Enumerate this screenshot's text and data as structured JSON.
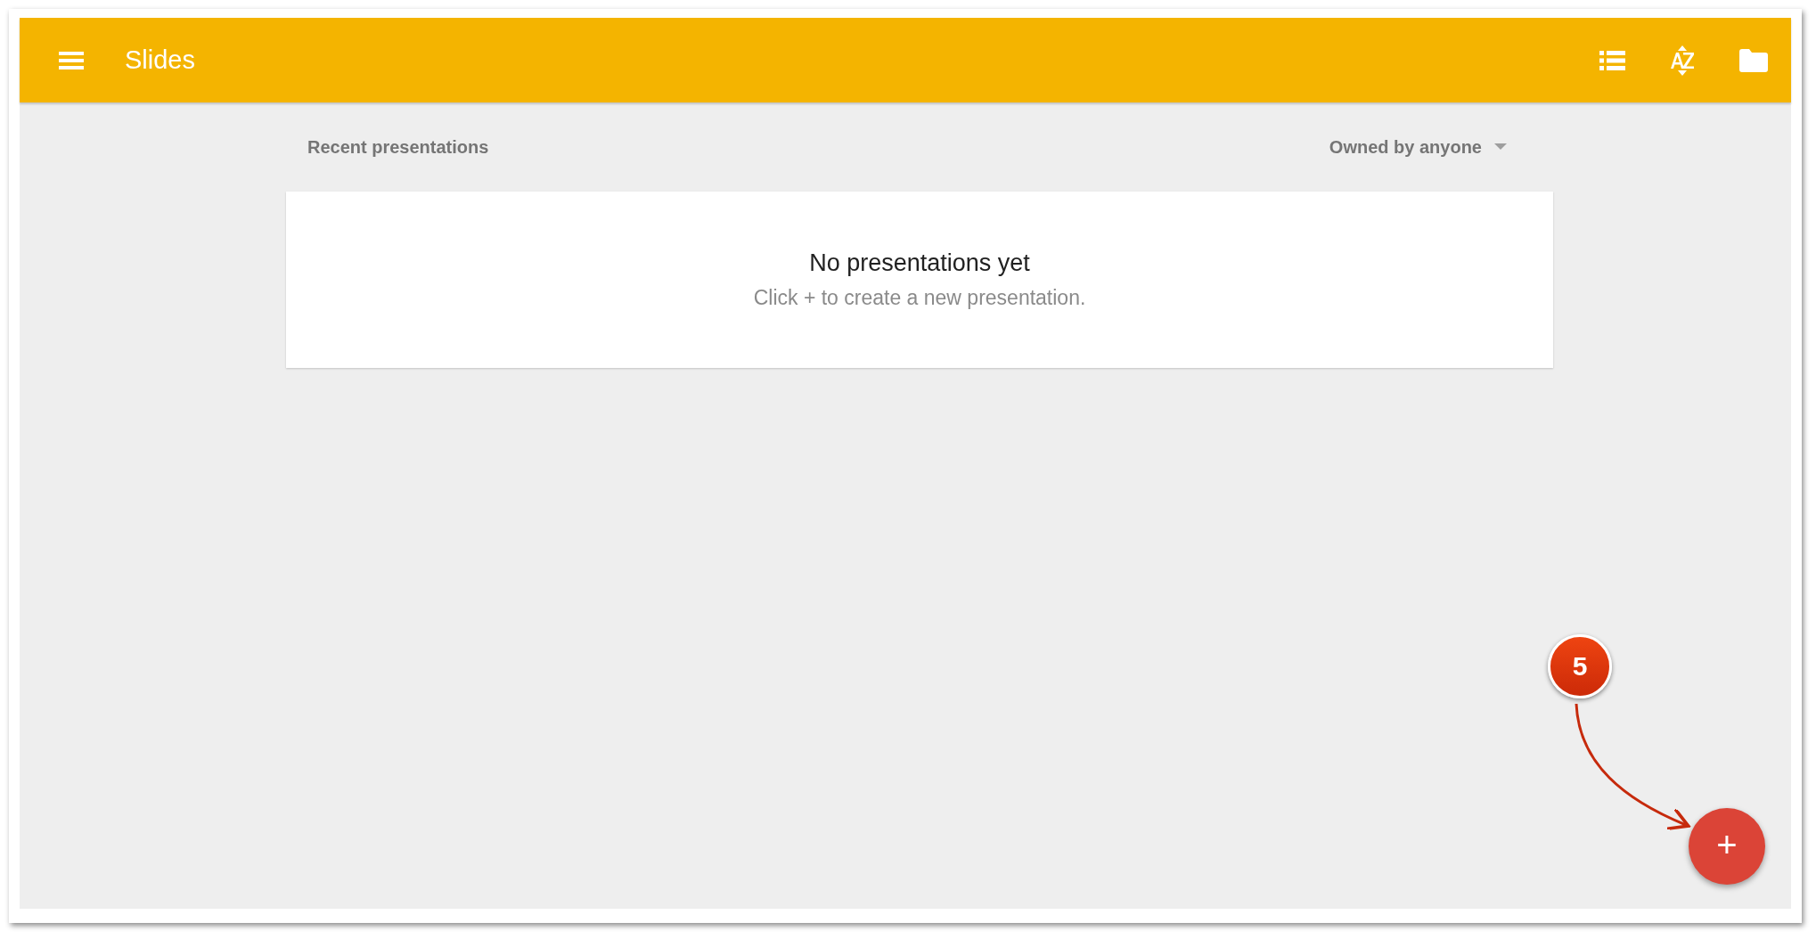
{
  "app_bar": {
    "title": "Slides"
  },
  "section": {
    "title": "Recent presentations",
    "filter": "Owned by anyone"
  },
  "empty_state": {
    "heading": "No presentations yet",
    "message": "Click + to create a new presentation."
  },
  "fab": {
    "label": "+"
  },
  "callout": {
    "number": "5"
  }
}
